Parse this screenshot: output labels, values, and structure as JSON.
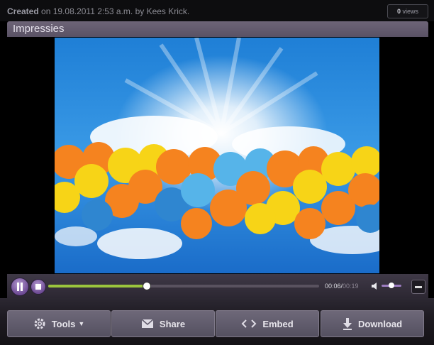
{
  "meta": {
    "created_prefix": "Created",
    "created_text": "on 19.08.2011 2:53 a.m. by Kees Krick.",
    "views_count": "0",
    "views_label": "views"
  },
  "title": "Impressies",
  "player": {
    "current_time": "00:06/",
    "total_time": "00:19",
    "progress": 0.36,
    "volume": 0.5
  },
  "actions": {
    "tools_label": "Tools",
    "share_label": "Share",
    "embed_label": "Embed",
    "download_label": "Download"
  },
  "icons": [
    "gear-icon",
    "envelope-icon",
    "code-icon",
    "download-icon",
    "pause-icon",
    "stop-icon",
    "volume-icon",
    "fullscreen-icon"
  ],
  "colors": {
    "accent_purple": "#8e6bb4",
    "progress_green": "#9bc53d",
    "title_bar": "#635a6e"
  }
}
